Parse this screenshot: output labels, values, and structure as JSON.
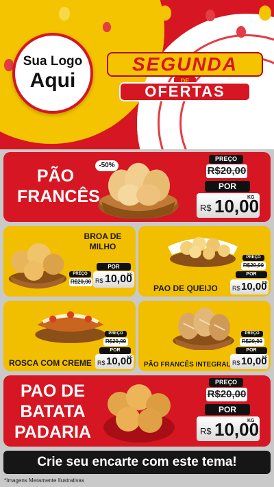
{
  "header": {
    "logo_line1": "Sua Logo",
    "logo_line2": "Aqui",
    "title_top": "SEGUNDA",
    "title_de": "DE",
    "title_bottom": "OFERTAS"
  },
  "badge_discount": "-50%",
  "labels": {
    "preco": "PREÇO",
    "por": "POR",
    "currency": "R$",
    "unit": "KG"
  },
  "products": {
    "pao_frances": {
      "name": "PÃO FRANCÊS",
      "old_price": "R$20,00",
      "price": "10,00"
    },
    "broa_milho": {
      "name": "BROA DE MILHO",
      "old_price": "R$20,00",
      "price": "10,00"
    },
    "pao_queijo": {
      "name": "PAO DE QUEIJO",
      "old_price": "R$20,00",
      "price": "10,00"
    },
    "rosca": {
      "name": "ROSCA COM CREME",
      "old_price": "R$20,00",
      "price": "10,00"
    },
    "frances_integral": {
      "name": "PÃO FRANCÊS INTEGRAL",
      "old_price": "R$20,00",
      "price": "10,00"
    },
    "pao_batata": {
      "name": "PAO DE BATATA PADARIA",
      "old_price": "R$20,00",
      "price": "10,00"
    }
  },
  "cta": "Crie seu encarte com este tema!",
  "disclaimer": "*Imagens Meramente Ilustrativas",
  "colors": {
    "red": "#d61622",
    "yellow": "#f2be00",
    "dark": "#111111"
  }
}
